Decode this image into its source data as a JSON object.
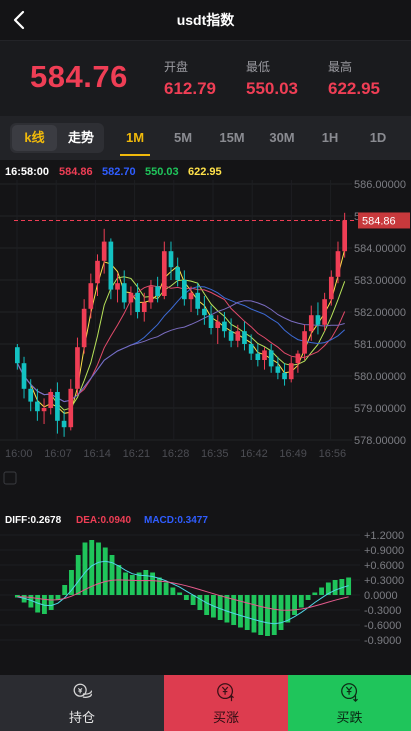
{
  "header": {
    "title": "usdt指数",
    "back_label": "back"
  },
  "quote": {
    "price": "584.76",
    "open_label": "开盘",
    "open": "612.79",
    "low_label": "最低",
    "low": "550.03",
    "high_label": "最高",
    "high": "622.95"
  },
  "tabs": {
    "chart_kline": "k线",
    "chart_trend": "走势",
    "periods": [
      "1M",
      "5M",
      "15M",
      "30M",
      "1H",
      "1D"
    ],
    "active_period": "1M"
  },
  "legend": {
    "time": "16:58:00",
    "ma_a": "584.86",
    "ma_b": "582.70",
    "ma_c": "550.03",
    "ma_d": "622.95"
  },
  "last_price_tag": "584.86",
  "macd": {
    "diff": "DIFF:0.2678",
    "dea": "DEA:0.0940",
    "macd": "MACD:0.3477"
  },
  "colors": {
    "up": "#ef3e55",
    "down": "#13c2c2",
    "accent": "#f0b90b",
    "bg": "#141416"
  },
  "chart_data": [
    {
      "type": "candlestick",
      "y_ticks": [
        "586.00000",
        "585.00000",
        "584.00000",
        "583.00000",
        "582.00000",
        "581.00000",
        "580.00000",
        "579.00000",
        "578.00000"
      ],
      "ylim": [
        578,
        586
      ],
      "x_ticks": [
        "16:00",
        "16:07",
        "16:14",
        "16:21",
        "16:28",
        "16:35",
        "16:42",
        "16:49",
        "16:56"
      ],
      "last": 584.86,
      "candles": [
        [
          580.9,
          581.0,
          580.2,
          580.4
        ],
        [
          580.4,
          580.6,
          579.3,
          579.6
        ],
        [
          579.6,
          579.9,
          578.9,
          579.2
        ],
        [
          579.2,
          579.6,
          578.6,
          578.9
        ],
        [
          578.9,
          579.3,
          578.5,
          579.0
        ],
        [
          579.0,
          579.6,
          578.8,
          579.5
        ],
        [
          579.5,
          579.8,
          578.2,
          578.6
        ],
        [
          578.6,
          578.9,
          578.1,
          578.4
        ],
        [
          578.4,
          579.9,
          578.3,
          579.6
        ],
        [
          579.6,
          581.2,
          579.4,
          580.9
        ],
        [
          580.9,
          582.4,
          580.7,
          582.1
        ],
        [
          582.1,
          583.2,
          581.8,
          582.9
        ],
        [
          582.9,
          583.8,
          582.5,
          583.6
        ],
        [
          583.6,
          584.6,
          583.2,
          584.2
        ],
        [
          584.2,
          584.3,
          582.4,
          582.7
        ],
        [
          582.7,
          583.2,
          582.3,
          582.9
        ],
        [
          582.9,
          583.3,
          582.1,
          582.3
        ],
        [
          582.3,
          582.8,
          581.9,
          582.6
        ],
        [
          582.6,
          582.9,
          581.8,
          582.0
        ],
        [
          582.0,
          582.6,
          581.7,
          582.3
        ],
        [
          582.3,
          583.0,
          582.1,
          582.8
        ],
        [
          582.8,
          583.1,
          582.3,
          582.5
        ],
        [
          582.5,
          584.2,
          582.4,
          583.9
        ],
        [
          583.9,
          584.2,
          583.0,
          583.4
        ],
        [
          583.4,
          583.7,
          582.8,
          583.0
        ],
        [
          583.0,
          583.3,
          582.2,
          582.4
        ],
        [
          582.4,
          582.8,
          582.0,
          582.6
        ],
        [
          582.6,
          582.9,
          581.9,
          582.1
        ],
        [
          582.1,
          582.5,
          581.6,
          581.9
        ],
        [
          581.9,
          582.2,
          581.3,
          581.5
        ],
        [
          581.5,
          581.9,
          581.0,
          581.7
        ],
        [
          581.7,
          582.0,
          581.2,
          581.4
        ],
        [
          581.4,
          581.8,
          580.9,
          581.1
        ],
        [
          581.1,
          581.6,
          580.9,
          581.4
        ],
        [
          581.4,
          581.7,
          580.8,
          581.0
        ],
        [
          581.0,
          581.3,
          580.5,
          580.7
        ],
        [
          580.7,
          581.0,
          580.3,
          580.5
        ],
        [
          580.5,
          580.9,
          580.2,
          580.8
        ],
        [
          580.8,
          581.0,
          580.1,
          580.3
        ],
        [
          580.3,
          580.6,
          579.9,
          580.1
        ],
        [
          580.1,
          580.4,
          579.7,
          579.9
        ],
        [
          579.9,
          580.6,
          579.8,
          580.4
        ],
        [
          580.4,
          580.8,
          580.1,
          580.7
        ],
        [
          580.7,
          581.6,
          580.5,
          581.4
        ],
        [
          581.4,
          582.2,
          581.1,
          581.9
        ],
        [
          581.9,
          582.3,
          581.3,
          581.6
        ],
        [
          581.6,
          582.6,
          581.4,
          582.4
        ],
        [
          582.4,
          583.3,
          582.2,
          583.1
        ],
        [
          583.1,
          584.2,
          582.9,
          583.9
        ],
        [
          583.9,
          585.1,
          583.7,
          584.86
        ]
      ]
    },
    {
      "type": "bar",
      "name": "MACD",
      "y_ticks": [
        "+1.2000",
        "+0.9000",
        "+0.6000",
        "+0.3000",
        "0.0000",
        "-0.3000",
        "-0.6000",
        "-0.9000"
      ],
      "ylim": [
        -1.2,
        1.2
      ],
      "values": [
        -0.05,
        -0.15,
        -0.25,
        -0.35,
        -0.38,
        -0.3,
        -0.1,
        0.2,
        0.5,
        0.8,
        1.05,
        1.1,
        1.05,
        0.95,
        0.8,
        0.6,
        0.45,
        0.4,
        0.45,
        0.5,
        0.45,
        0.35,
        0.25,
        0.15,
        0.05,
        -0.1,
        -0.2,
        -0.3,
        -0.4,
        -0.45,
        -0.5,
        -0.55,
        -0.6,
        -0.65,
        -0.7,
        -0.75,
        -0.8,
        -0.82,
        -0.8,
        -0.7,
        -0.55,
        -0.4,
        -0.25,
        -0.1,
        0.05,
        0.15,
        0.25,
        0.3,
        0.32,
        0.35
      ]
    }
  ],
  "bottom": {
    "hold": "持仓",
    "buy_up": "买涨",
    "buy_down": "买跌"
  }
}
